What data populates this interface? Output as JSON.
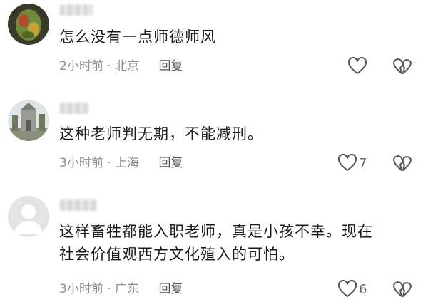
{
  "comments": [
    {
      "text_lines": [
        "怎么没有一点师德师风"
      ],
      "time": "2小时前",
      "location": "北京",
      "reply_label": "回复",
      "like_count": ""
    },
    {
      "text_lines": [
        "这种老师判无期，不能减刑。"
      ],
      "time": "3小时前",
      "location": "上海",
      "reply_label": "回复",
      "like_count": "7"
    },
    {
      "text_lines": [
        "这样畜牲都能入职老师，真是小孩不幸。现在",
        "社会价值观西方文化殖入的可怕。"
      ],
      "time": "3小时前",
      "location": "广东",
      "reply_label": "回复",
      "like_count": "6"
    }
  ],
  "separator": "·",
  "colors": {
    "text": "#1a1a1a",
    "meta": "#8e8e8e",
    "icon": "#555555"
  }
}
